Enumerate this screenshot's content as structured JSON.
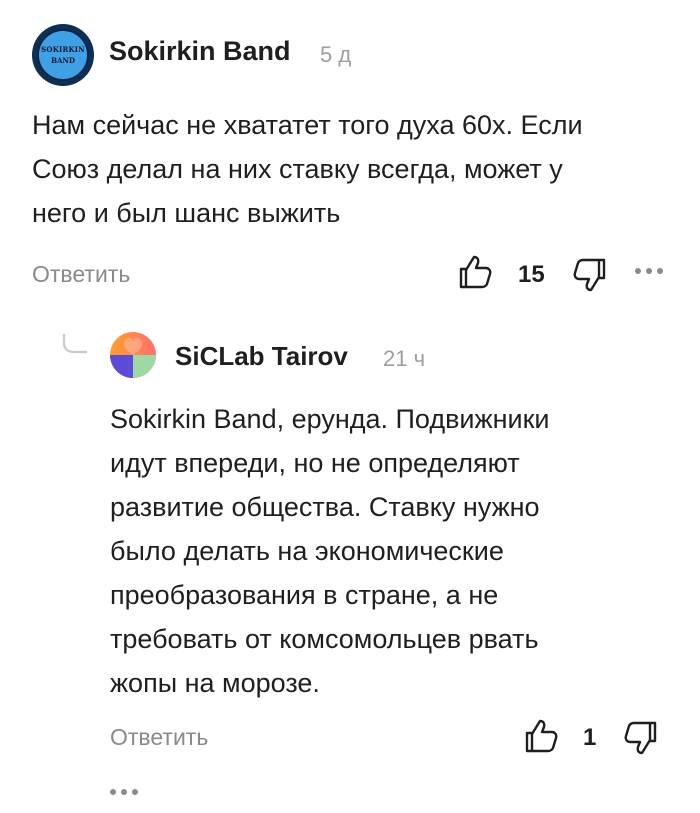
{
  "comments": [
    {
      "author": "Sokirkin Band",
      "time": "5 д",
      "avatar_text": [
        "SOKIRKIN",
        "BAND"
      ],
      "text_lines": [
        "Нам сейчас не хвататет того духа 60х. Если",
        "Союз делал на них ставку всегда, может у",
        "него и был шанс выжить"
      ],
      "reply_label": "Ответить",
      "like_count": "15"
    },
    {
      "author": "SiCLab Tairov",
      "time": "21 ч",
      "text_lines": [
        "Sokirkin Band, ерунда. Подвижники",
        "идут впереди, но не определяют",
        "развитие общества. Ставку нужно",
        "было делать на экономические",
        "преобразования в стране, а не",
        "требовать от комсомольцев рвать",
        "жопы на морозе."
      ],
      "reply_label": "Ответить",
      "like_count": "1"
    }
  ],
  "icons": {
    "like": "thumbs-up-icon",
    "dislike": "thumbs-down-icon",
    "more": "more-dots-icon",
    "thread": "reply-thread-icon"
  },
  "colors": {
    "text": "#1f1f1f",
    "muted": "#8a8a8a",
    "avatar2_orange": "#ff7a3d",
    "avatar2_pink": "#ff6f6f",
    "avatar2_purple": "#5b4bd6",
    "avatar2_green": "#9ed9a5"
  }
}
